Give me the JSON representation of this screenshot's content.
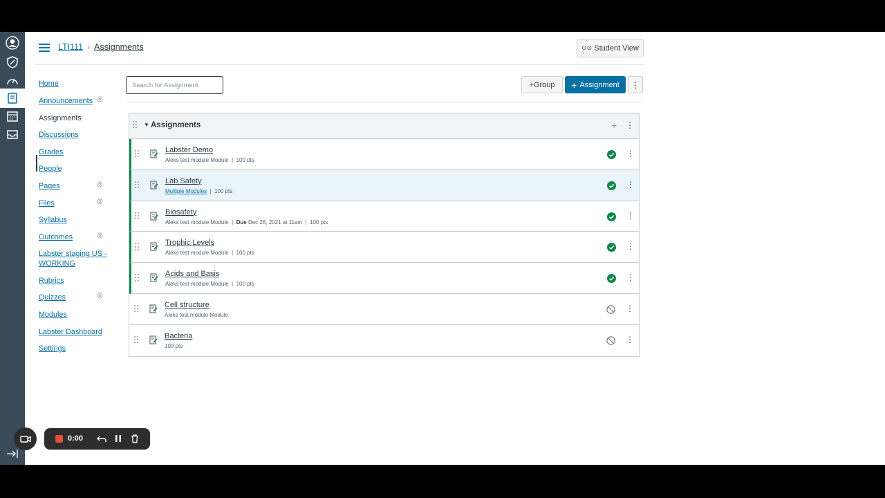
{
  "header": {
    "breadcrumb": [
      "LTI111",
      "Assignments"
    ],
    "student_view_label": "Student View"
  },
  "global_nav": {
    "items": [
      "account",
      "admin",
      "dashboard",
      "courses",
      "calendar",
      "inbox"
    ],
    "active": "courses"
  },
  "course_nav": {
    "items": [
      {
        "label": "Home",
        "hidden": false
      },
      {
        "label": "Announcements",
        "hidden": true
      },
      {
        "label": "Assignments",
        "hidden": false,
        "active": true
      },
      {
        "label": "Discussions",
        "hidden": false
      },
      {
        "label": "Grades",
        "hidden": false
      },
      {
        "label": "People",
        "hidden": false
      },
      {
        "label": "Pages",
        "hidden": true
      },
      {
        "label": "Files",
        "hidden": true
      },
      {
        "label": "Syllabus",
        "hidden": false
      },
      {
        "label": "Outcomes",
        "hidden": true
      },
      {
        "label": "Labster staging US - WORKING",
        "hidden": false
      },
      {
        "label": "Rubrics",
        "hidden": false
      },
      {
        "label": "Quizzes",
        "hidden": true
      },
      {
        "label": "Modules",
        "hidden": false
      },
      {
        "label": "Labster Dashboard",
        "hidden": false
      },
      {
        "label": "Settings",
        "hidden": false
      }
    ]
  },
  "toolbar": {
    "search_placeholder": "Search for Assignment",
    "group_label": "Group",
    "group_plus": "+",
    "assignment_label": "Assignment",
    "assignment_plus": "+",
    "kebab": "⋮"
  },
  "group": {
    "title": "Assignments",
    "plus": "+",
    "kebab": "⋮",
    "assignments": [
      {
        "name": "Labster Demo",
        "module": "Aleks test module Module",
        "due_label": "",
        "due": "",
        "points": "100 pts",
        "published": true,
        "highlight": false
      },
      {
        "name": "Lab Safety",
        "module": "Multiple Modules",
        "module_link": true,
        "due_label": "",
        "due": "",
        "points": "100 pts",
        "published": true,
        "highlight": true
      },
      {
        "name": "Biosafety",
        "module": "Aleks test module Module",
        "due_label": "Due",
        "due": "Dec 28, 2021 at 11am",
        "points": "100 pts",
        "published": true,
        "highlight": false
      },
      {
        "name": "Trophic Levels",
        "module": "Aleks test module Module",
        "due_label": "",
        "due": "",
        "points": "100 pts",
        "published": true,
        "highlight": false
      },
      {
        "name": "Acids and Basis",
        "module": "Aleks test module Module",
        "due_label": "",
        "due": "",
        "points": "100 pts",
        "published": true,
        "highlight": false
      },
      {
        "name": "Cell structure",
        "module": "Aleks test module Module",
        "due_label": "",
        "due": "",
        "points": "",
        "published": false,
        "highlight": false
      },
      {
        "name": "Bacteria",
        "module": "",
        "due_label": "",
        "due": "",
        "points": "100 pts",
        "published": false,
        "highlight": false
      }
    ]
  },
  "recorder": {
    "time": "0:00"
  },
  "colors": {
    "brand": "#0770a3",
    "published": "#0b874b",
    "nav_bg": "#394b58",
    "recorder_bg": "#2d2d2d",
    "stop": "#e04e3d"
  }
}
